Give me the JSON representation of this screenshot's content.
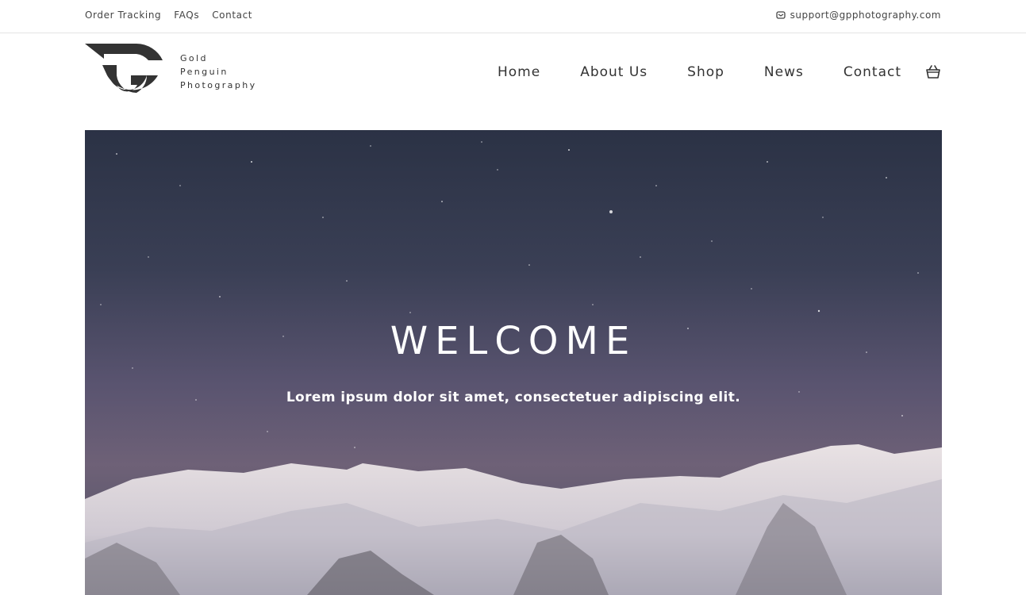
{
  "topbar": {
    "links": [
      "Order Tracking",
      "FAQs",
      "Contact"
    ],
    "email": "support@gpphotography.com",
    "email_icon": "mail-icon"
  },
  "brand": {
    "logo_icon": "gpp-logo-icon",
    "line1": "Gold",
    "line2": "Penguin",
    "line3": "Photography"
  },
  "nav": {
    "items": [
      "Home",
      "About Us",
      "Shop",
      "News",
      "Contact"
    ],
    "cart_icon": "basket-icon"
  },
  "hero": {
    "title": "WELCOME",
    "subtitle": "Lorem ipsum dolor sit amet, consectetuer adipiscing elit."
  },
  "colors": {
    "text": "#333333",
    "hero_text": "#ffffff",
    "divider": "#e4e4e4"
  }
}
